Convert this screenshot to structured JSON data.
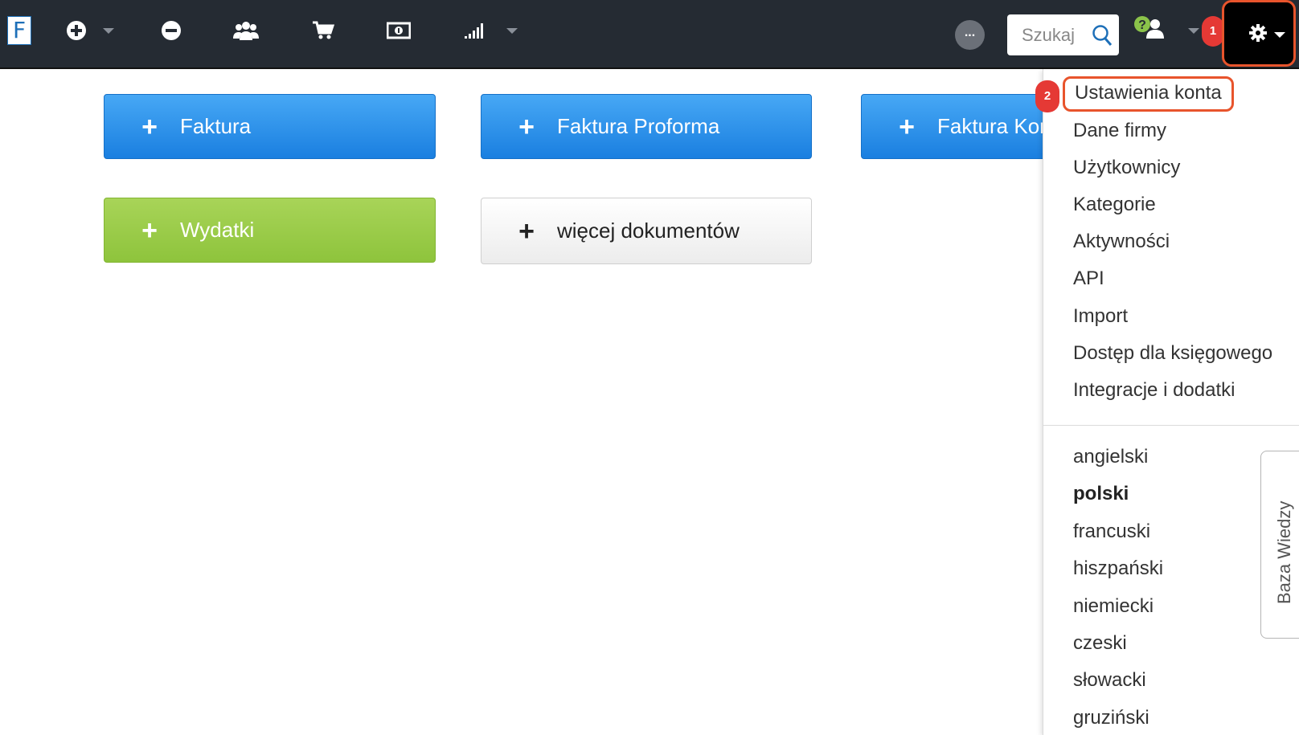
{
  "app": {
    "logo_letter": "F"
  },
  "toolbar": {
    "search_placeholder": "Szukaj",
    "more_label": "...",
    "badge_1": "1",
    "badge_2": "2"
  },
  "actions": {
    "faktura": "Faktura",
    "proforma": "Faktura Proforma",
    "korekta": "Faktura Korekta",
    "wydatki": "Wydatki",
    "more_docs": "więcej dokumentów",
    "plus": "+"
  },
  "settings_menu": {
    "items": [
      "Ustawienia konta",
      "Dane firmy",
      "Użytkownicy",
      "Kategorie",
      "Aktywności",
      "API",
      "Import",
      "Dostęp dla księgowego",
      "Integracje i dodatki"
    ],
    "languages": [
      "angielski",
      "polski",
      "francuski",
      "hiszpański",
      "niemiecki",
      "czeski",
      "słowacki",
      "gruziński"
    ],
    "selected_language": "polski"
  },
  "knowledge_base": {
    "label": "Baza Wiedzy"
  },
  "colors": {
    "topbar": "#252b33",
    "blue_button": "#1a7fe0",
    "green_button": "#8ec43c",
    "highlight": "#e8542c",
    "badge": "#e53935"
  }
}
